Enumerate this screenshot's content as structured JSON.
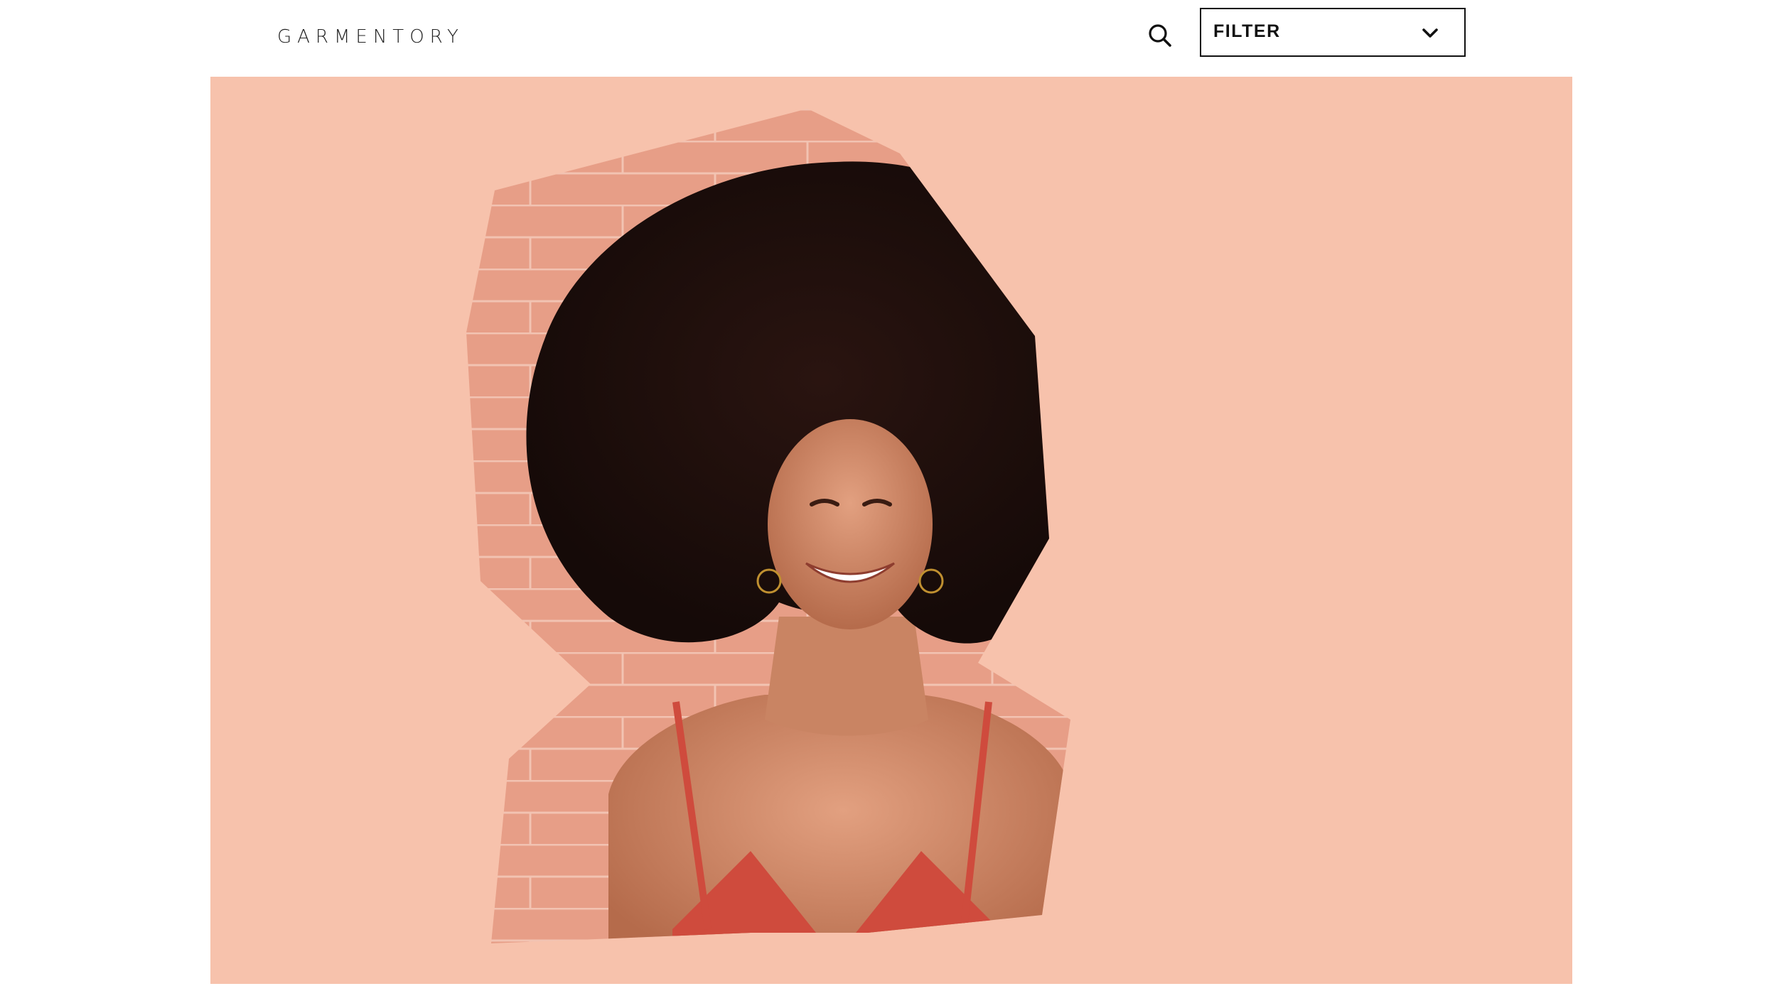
{
  "brand": {
    "logo_text": "GARMENTORY"
  },
  "header": {
    "search_icon": "search-icon",
    "filter": {
      "label": "FILTER",
      "icon": "chevron-down-icon"
    }
  },
  "hero": {
    "background_color": "#f7c2ac",
    "image_alt": "Smiling woman with voluminous curly hair in a red camisole against a pink brick wall"
  }
}
